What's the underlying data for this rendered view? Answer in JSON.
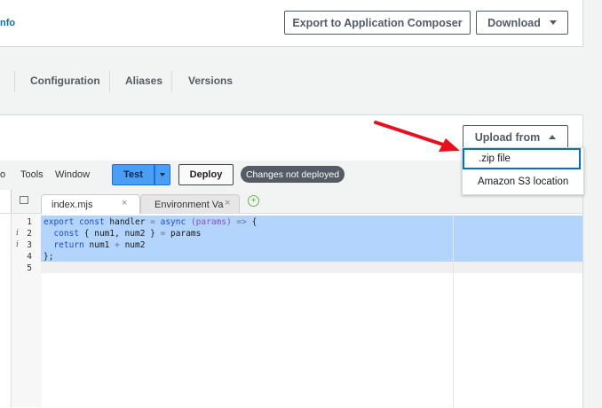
{
  "header": {
    "info_link": "nfo",
    "export_label": "Export to Application Composer",
    "download_label": "Download"
  },
  "tabs": [
    {
      "label": "Configuration"
    },
    {
      "label": "Aliases"
    },
    {
      "label": "Versions"
    }
  ],
  "upload": {
    "button_label": "Upload from",
    "menu": [
      {
        "label": ".zip file",
        "focused": true
      },
      {
        "label": "Amazon S3 location",
        "focused": false
      }
    ]
  },
  "ide": {
    "menu": [
      "Go",
      "Tools",
      "Window"
    ],
    "menu_visible": [
      "o",
      "Tools",
      "Window"
    ],
    "test_label": "Test",
    "deploy_label": "Deploy",
    "status_badge": "Changes not deployed",
    "editor_tabs": [
      {
        "label": "index.mjs",
        "active": true
      },
      {
        "label": "Environment Var",
        "active": false
      }
    ],
    "line_numbers": [
      "1",
      "2",
      "3",
      "4",
      "5"
    ],
    "info_marker": "i",
    "code": {
      "l1_kw1": "export",
      "l1_kw2": "const",
      "l1_name": " handler ",
      "l1_eq": "=",
      "l1_kw3": " async",
      "l1_param": " (params)",
      "l1_arrow": " =>",
      "l1_end": " {",
      "l2_kw": "const",
      "l2_rest": " { num1, num2 } ",
      "l2_eq": "=",
      "l2_end": " params",
      "l3_kw": "return",
      "l3_rest": " num1 ",
      "l3_op": "+",
      "l3_end": " num2",
      "l4": "};"
    }
  },
  "colors": {
    "accent": "#0073bb",
    "test_button": "#4b9ef4",
    "selection": "#b3d4fc",
    "arrow": "#e8101c"
  },
  "icons": [
    "caret-down-icon",
    "caret-up-icon",
    "close-icon",
    "add-icon",
    "file-tree-icon",
    "red-arrow-annotation"
  ]
}
